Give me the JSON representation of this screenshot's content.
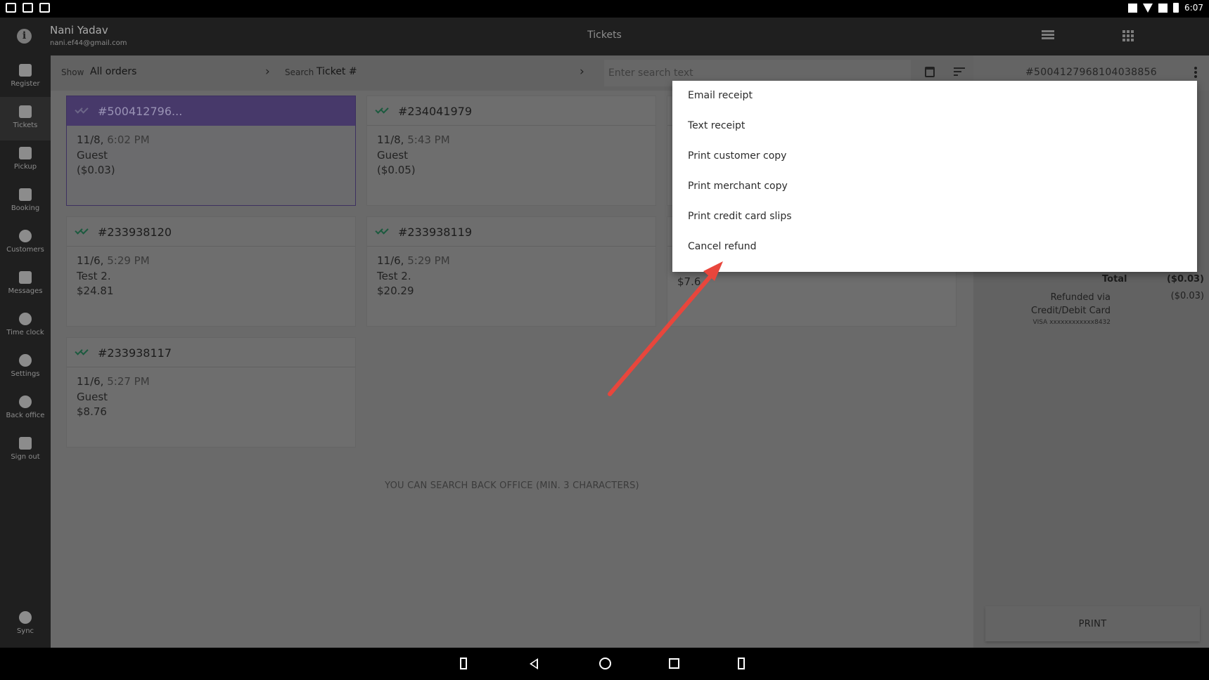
{
  "status_bar": {
    "time": "6:07"
  },
  "header": {
    "user_name": "Nani Yadav",
    "user_email": "nani.ef44@gmail.com",
    "title": "Tickets"
  },
  "nav": [
    {
      "label": "Register",
      "icon": "cart-icon"
    },
    {
      "label": "Tickets",
      "icon": "receipt-icon",
      "active": true
    },
    {
      "label": "Pickup",
      "icon": "traffic-light-icon"
    },
    {
      "label": "Booking",
      "icon": "calendar-icon"
    },
    {
      "label": "Customers",
      "icon": "people-icon"
    },
    {
      "label": "Messages",
      "icon": "chat-icon"
    },
    {
      "label": "Time clock",
      "icon": "clock-icon"
    },
    {
      "label": "Settings",
      "icon": "gear-icon"
    },
    {
      "label": "Back office",
      "icon": "cloud-icon"
    },
    {
      "label": "Sign out",
      "icon": "lock-icon"
    },
    {
      "label": "Sync",
      "icon": "sync-icon"
    }
  ],
  "filters": {
    "show_label": "Show",
    "show_value": "All orders",
    "search_label": "Search",
    "search_value": "Ticket #",
    "search_placeholder": "Enter search text"
  },
  "detail": {
    "ticket_number": "#5004127968104038856",
    "total_label": "Total",
    "total_value": "($0.03)",
    "refund_label": "Refunded via Credit/Debit Card",
    "refund_value": "($0.03)",
    "card_text": "VISA xxxxxxxxxxxx8432",
    "print_label": "PRINT"
  },
  "tickets": [
    {
      "number": "#500412796...",
      "date": "11/8,",
      "time": "6:02 PM",
      "name": "Guest",
      "amount": "($0.03)",
      "selected": true
    },
    {
      "number": "#234041979",
      "date": "11/8,",
      "time": "5:43 PM",
      "name": "Guest",
      "amount": "($0.05)"
    },
    {
      "number": "#233938120",
      "date": "11/6,",
      "time": "5:29 PM",
      "name": "Test 2.",
      "amount": "$24.81"
    },
    {
      "number": "#233938119",
      "date": "11/6,",
      "time": "5:29 PM",
      "name": "Test 2.",
      "amount": "$20.29"
    },
    {
      "number": "#233938117",
      "date": "11/6,",
      "time": "5:27 PM",
      "name": "Guest",
      "amount": "$8.76"
    }
  ],
  "partial_card_amount": "$7.6",
  "hint": "YOU CAN SEARCH BACK OFFICE (MIN. 3 CHARACTERS)",
  "menu": [
    "Email receipt",
    "Text receipt",
    "Print customer copy",
    "Print merchant copy",
    "Print credit card slips",
    "Cancel refund"
  ],
  "colors": {
    "accent_selected": "#47396a",
    "check_green": "#1b5a3e",
    "annotation_arrow": "#e8463c"
  }
}
